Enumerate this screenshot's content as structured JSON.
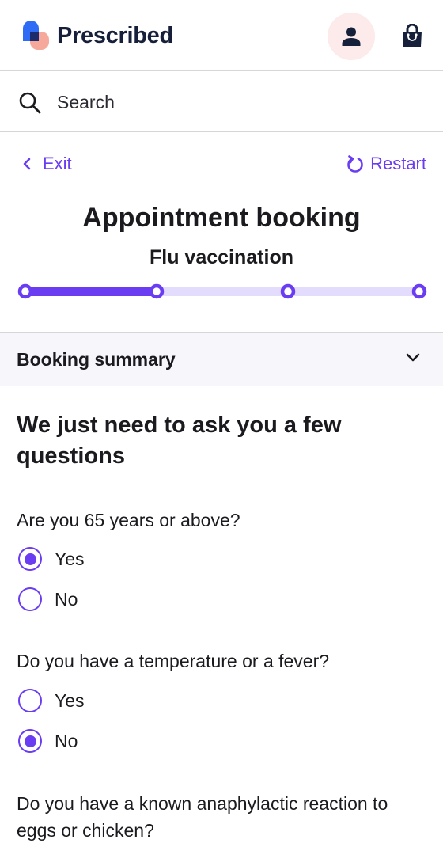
{
  "header": {
    "brand": "Prescribed",
    "icons": {
      "logo": "prescribed-logo",
      "account": "person-icon",
      "basket": "shopping-bag-icon"
    }
  },
  "search": {
    "placeholder": "Search",
    "icon": "search-icon"
  },
  "nav": {
    "exit_label": "Exit",
    "restart_label": "Restart"
  },
  "page": {
    "title": "Appointment booking",
    "subtitle": "Flu vaccination"
  },
  "progress": {
    "steps": 4,
    "current_step": 2
  },
  "summary": {
    "label": "Booking summary",
    "expanded": false
  },
  "questions_heading": "We just need to ask you a few questions",
  "questions": [
    {
      "text": "Are you 65 years or above?",
      "options": [
        {
          "label": "Yes",
          "selected": true
        },
        {
          "label": "No",
          "selected": false
        }
      ]
    },
    {
      "text": "Do you have a temperature or a fever?",
      "options": [
        {
          "label": "Yes",
          "selected": false
        },
        {
          "label": "No",
          "selected": true
        }
      ]
    },
    {
      "text": "Do you have a known anaphylactic reaction to eggs or chicken?",
      "options": []
    }
  ],
  "colors": {
    "accent": "#6b3df2",
    "accent_light": "#e3dcfc",
    "brand_text": "#17203a",
    "account_bg": "#fcebea"
  }
}
